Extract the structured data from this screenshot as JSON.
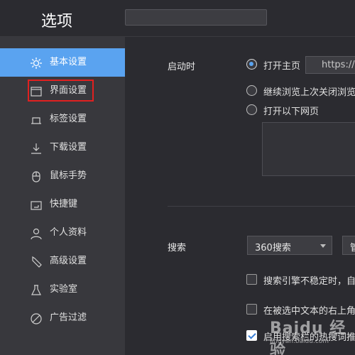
{
  "window": {
    "title": "选项"
  },
  "sidebar": {
    "items": [
      {
        "label": "基本设置",
        "icon": "gear-icon",
        "active": true
      },
      {
        "label": "界面设置",
        "icon": "window-icon",
        "active": false
      },
      {
        "label": "标签设置",
        "icon": "tab-icon",
        "active": false
      },
      {
        "label": "下载设置",
        "icon": "download-icon",
        "active": false
      },
      {
        "label": "鼠标手势",
        "icon": "mouse-icon",
        "active": false
      },
      {
        "label": "快捷键",
        "icon": "keyboard-icon",
        "active": false
      },
      {
        "label": "个人资料",
        "icon": "user-icon",
        "active": false
      },
      {
        "label": "高级设置",
        "icon": "wrench-icon",
        "active": false
      },
      {
        "label": "实验室",
        "icon": "flask-icon",
        "active": false
      },
      {
        "label": "广告过滤",
        "icon": "block-icon",
        "active": false
      }
    ]
  },
  "startup": {
    "label": "启动时",
    "options": [
      {
        "label": "打开主页",
        "selected": true
      },
      {
        "label": "继续浏览上次关闭浏览",
        "selected": false
      },
      {
        "label": "打开以下网页",
        "selected": false
      }
    ],
    "homepage_value": "https://h"
  },
  "search": {
    "label": "搜索",
    "engine_selected": "360搜索",
    "manage_label": "管",
    "checkboxes": [
      {
        "label": "搜索引擎不稳定时，自",
        "checked": false
      },
      {
        "label": "在被选中文本的右上角",
        "checked": false
      },
      {
        "label": "启用搜索栏的热搜词推",
        "checked": true
      }
    ]
  },
  "watermark": {
    "text": "Baidu 经验",
    "sub": "jingyan.baidu.com"
  },
  "colors": {
    "accent": "#5aa3f0",
    "highlight": "#e02020",
    "background": "#2b2b30",
    "sidebar": "#38383d"
  }
}
